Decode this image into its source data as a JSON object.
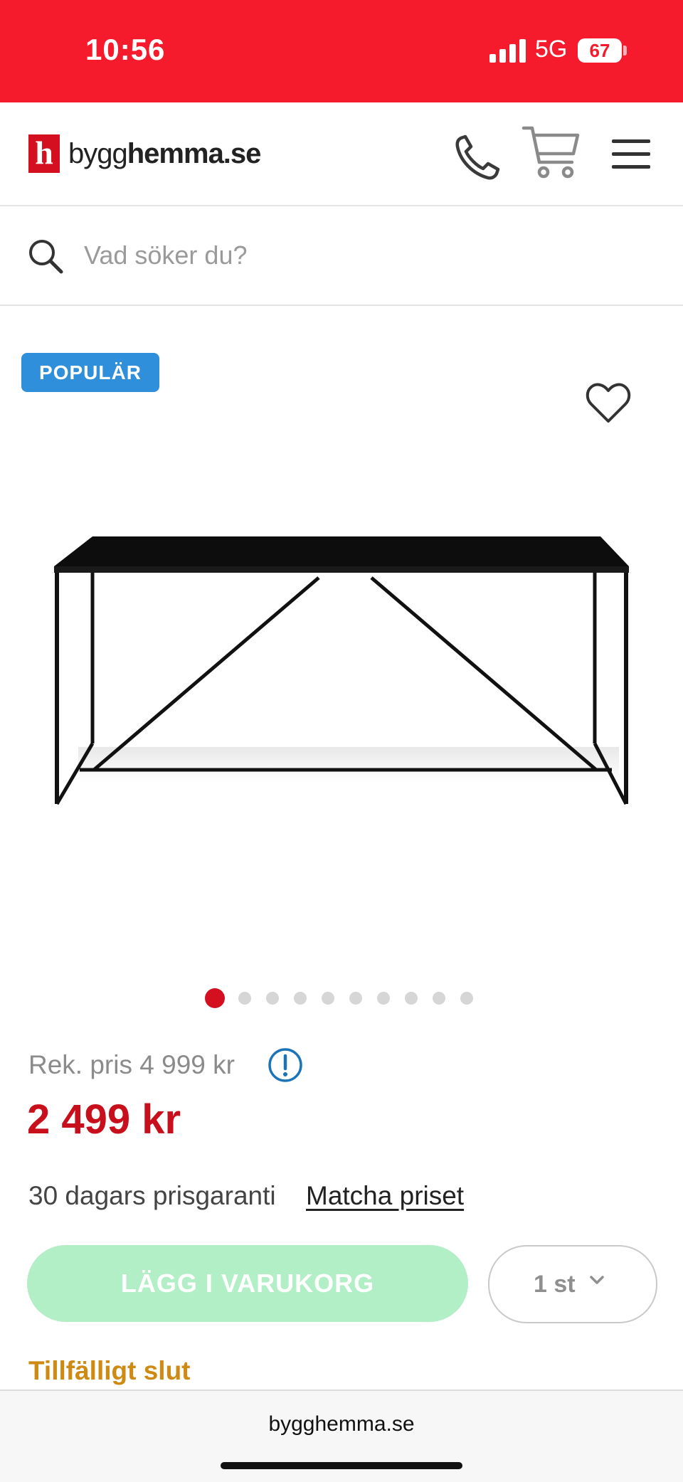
{
  "status_bar": {
    "time": "10:56",
    "network": "5G",
    "battery": "67",
    "background_color": "#f61b2c"
  },
  "header": {
    "logo_mark": "h",
    "logo_text_light": "bygg",
    "logo_text_bold": "hemma.se",
    "icons": [
      "phone-icon",
      "cart-icon",
      "menu-icon"
    ]
  },
  "search": {
    "placeholder": "Vad söker du?",
    "icon": "search-icon"
  },
  "product": {
    "badge": "POPULÄR",
    "image_description_icon": "table-image",
    "gallery": {
      "total_images": 10,
      "active_index": 0
    },
    "rek_price": "Rek. pris 4 999 kr",
    "price": "2 499 kr",
    "price_color": "#c8101d",
    "guarantee_text": "30 dagars prisgaranti",
    "match_link": "Matcha priset",
    "add_to_cart": "LÄGG I VARUKORG",
    "quantity": "1 st",
    "stock_status": "Tillfälligt slut"
  },
  "browser": {
    "url": "bygghemma.se"
  }
}
